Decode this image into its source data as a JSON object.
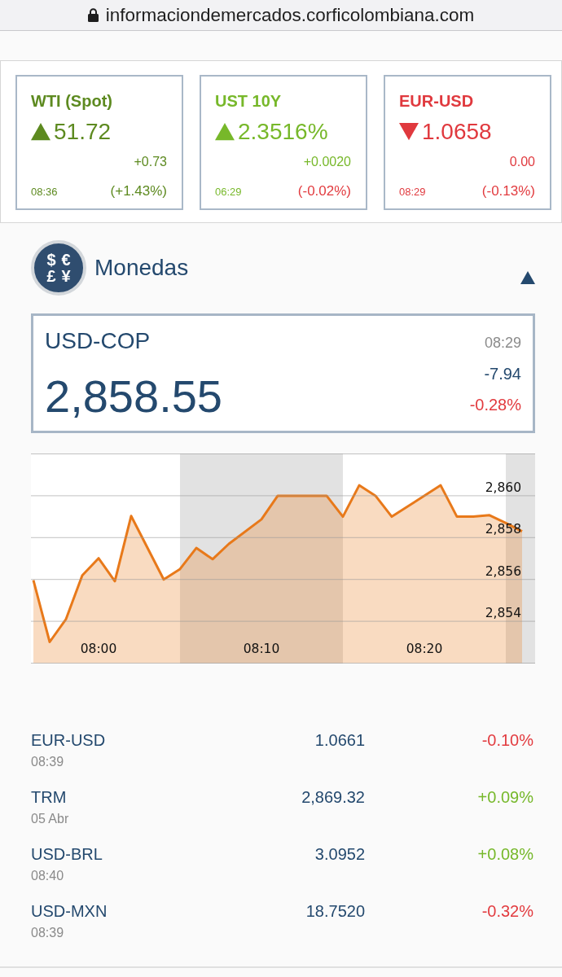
{
  "address_bar": {
    "url": "informaciondemercados.corficolombiana.com",
    "secure": true
  },
  "tickers": [
    {
      "name": "WTI (Spot)",
      "color": "#5d8a20",
      "up": true,
      "value": "51.72",
      "change": "+0.73",
      "time": "08:36",
      "percent": "(+1.43%)",
      "percent_up": true
    },
    {
      "name": "UST 10Y",
      "color": "#77b82a",
      "up": true,
      "value": "2.3516%",
      "change": "+0.0020",
      "time": "06:29",
      "percent": "(-0.02%)",
      "percent_up": false
    },
    {
      "name": "EUR-USD",
      "color": "#e0393e",
      "up": false,
      "value": "1.0658",
      "change": "0.00",
      "time": "08:29",
      "percent": "(-0.13%)",
      "percent_up": false
    }
  ],
  "section": {
    "title": "Monedas",
    "icon_glyphs": [
      "$",
      "€",
      "£",
      "¥"
    ],
    "expanded": true,
    "featured": {
      "pair": "USD-COP",
      "price": "2,858.55",
      "time": "08:29",
      "change": "-7.94",
      "percent": "-0.28%",
      "percent_up": false
    },
    "chart_data": {
      "type": "area",
      "grid": true,
      "categories": [
        null,
        null,
        null,
        null,
        "08:00",
        null,
        null,
        null,
        null,
        null,
        null,
        null,
        null,
        null,
        "08:10",
        null,
        null,
        null,
        null,
        null,
        null,
        null,
        null,
        null,
        "08:20",
        null,
        null,
        null,
        null,
        null,
        null
      ],
      "series": [
        {
          "color": "#e8791a",
          "values": [
            2855.96,
            2853.01,
            2854.1,
            2856.19,
            2857.01,
            2855.92,
            2859.03,
            null,
            2856.0,
            2856.5,
            2857.5,
            2856.97,
            2857.7,
            null,
            2858.87,
            2860,
            null,
            null,
            2860,
            2859,
            2860.5,
            2860,
            2859,
            null,
            null,
            2860.5,
            2859,
            2859,
            2859.07,
            2858.7,
            2858.3
          ]
        }
      ],
      "ylim": [
        2852,
        2862
      ],
      "yticks": [
        {
          "value": 2854,
          "label": "2,854"
        },
        {
          "value": 2856,
          "label": "2,856"
        },
        {
          "value": 2858,
          "label": "2,858"
        },
        {
          "value": 2860,
          "label": "2,860"
        }
      ]
    },
    "rates": [
      {
        "pair": "EUR-USD",
        "time": "08:39",
        "value": "1.0661",
        "percent": "-0.10%",
        "up": false
      },
      {
        "pair": "TRM",
        "time": "05 Abr",
        "value": "2,869.32",
        "percent": "+0.09%",
        "up": true
      },
      {
        "pair": "USD-BRL",
        "time": "08:40",
        "value": "3.0952",
        "percent": "+0.08%",
        "up": true
      },
      {
        "pair": "USD-MXN",
        "time": "08:39",
        "value": "18.7520",
        "percent": "-0.32%",
        "up": false
      }
    ]
  }
}
